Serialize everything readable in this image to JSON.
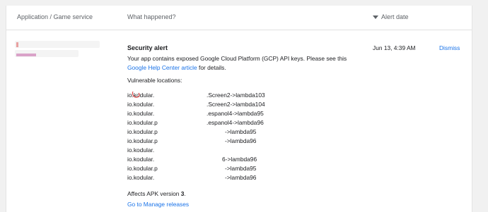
{
  "table": {
    "col_app": "Application / Game service",
    "col_what": "What happened?",
    "col_date": "Alert date"
  },
  "alert": {
    "title": "Security alert",
    "body_prefix": "Your app contains exposed Google Cloud Platform (GCP) API keys. Please see this ",
    "body_link": "Google Help Center article",
    "body_suffix": " for details.",
    "vulnerable_label": "Vulnerable locations:",
    "locations": [
      {
        "start": "io.kodular.",
        "end": ".Screen2->lambda103"
      },
      {
        "start": "io.kodular.",
        "end": ".Screen2->lambda104"
      },
      {
        "start": "io.kodular.",
        "end": ".espanol4->lambda95"
      },
      {
        "start": "io.kodular.p",
        "end": ".espanol4->lambda96"
      },
      {
        "start": "io.kodular.p",
        "end": "->lambda95"
      },
      {
        "start": "io.kodular.p",
        "end": "->lambda96"
      },
      {
        "start": "io.kodular.",
        "end": ""
      },
      {
        "start": "io.kodular.",
        "end": "6->lambda96"
      },
      {
        "start": "io.kodular.p",
        "end": "->lambda95"
      },
      {
        "start": "io.kodular.",
        "end": "->lambda96"
      }
    ],
    "affects_prefix": "Affects APK version ",
    "affects_version": "3",
    "affects_suffix": ".",
    "manage_link": "Go to Manage releases",
    "date": "Jun 13, 4:39 AM",
    "dismiss": "Dismiss"
  },
  "icons": {
    "sort": "sort-down-icon"
  },
  "colors": {
    "link": "#1a73e8",
    "text": "#202124",
    "muted": "#5f6368"
  }
}
